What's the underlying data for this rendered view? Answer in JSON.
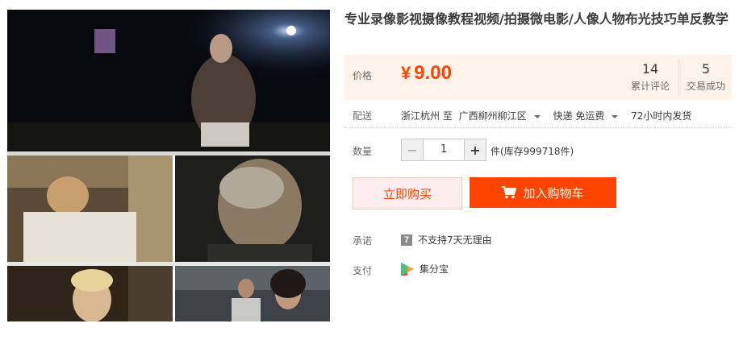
{
  "product": {
    "title": "专业录像影视摄像教程视频/拍摄微电影/人像人物布光技巧单反教学"
  },
  "price": {
    "label": "价格",
    "currency": "¥",
    "value": "9.00",
    "color": "#ff4400"
  },
  "stats": {
    "reviews_count": "14",
    "reviews_label": "累计评论",
    "deals_count": "5",
    "deals_label": "交易成功"
  },
  "shipping": {
    "label": "配送",
    "from": "浙江杭州 至",
    "to": "广西柳州柳江区",
    "method": "快递 免运费",
    "dispatch": "72小时内发货"
  },
  "quantity": {
    "label": "数量",
    "value": "1",
    "minus": "−",
    "plus": "+",
    "stock_text": "件(库存999718件)"
  },
  "actions": {
    "buy_now": "立即购买",
    "add_to_cart": "加入购物车"
  },
  "promise": {
    "label": "承诺",
    "badge": "7",
    "text": "不支持7天无理由"
  },
  "payment": {
    "label": "支付",
    "method": "集分宝",
    "icon": "jifenbao-icon"
  }
}
